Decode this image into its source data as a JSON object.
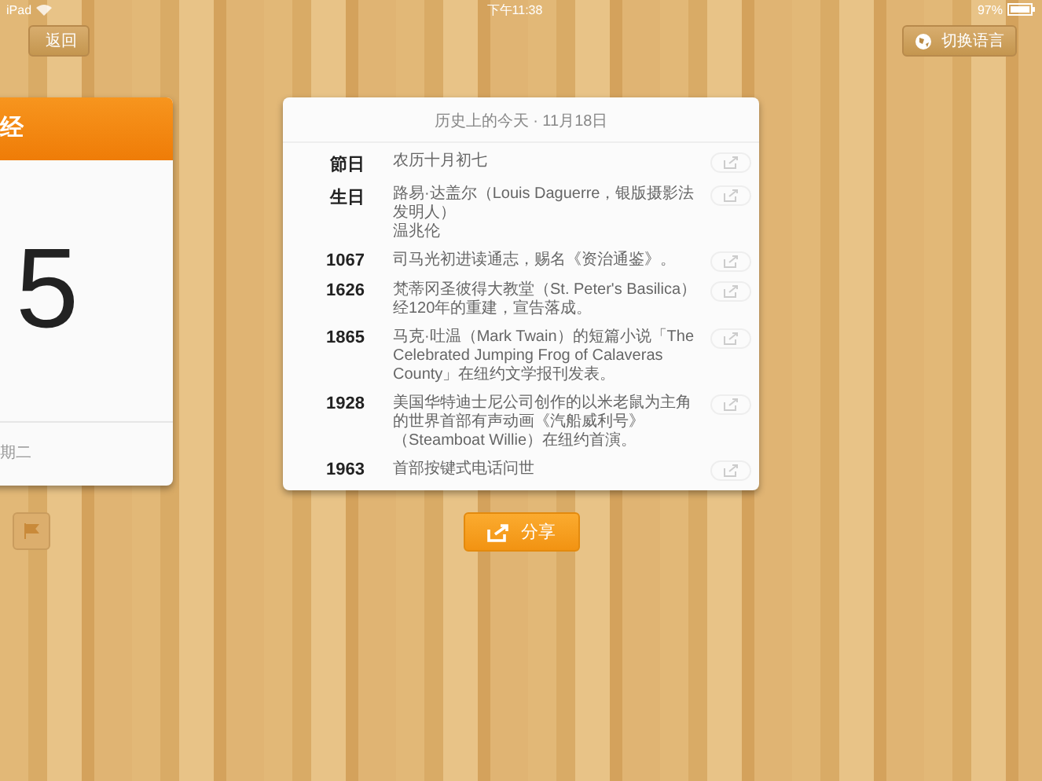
{
  "status_bar": {
    "device": "iPad",
    "time": "下午11:38",
    "battery": "97%"
  },
  "nav": {
    "back": "返回",
    "language": "切换语言"
  },
  "calendar_card": {
    "header": "经",
    "day": "5",
    "weekday": "期二"
  },
  "history_card": {
    "title": "历史上的今天 · 11月18日",
    "rows": [
      {
        "label": "節日",
        "lines": [
          "农历十月初七"
        ]
      },
      {
        "label": "生日",
        "lines": [
          "路易·达盖尔（Louis Daguerre，银版摄影法发明人）",
          "温兆伦"
        ]
      },
      {
        "label": "1067",
        "lines": [
          "司马光初进读通志，赐名《资治通鉴》。"
        ]
      },
      {
        "label": "1626",
        "lines": [
          "梵蒂冈圣彼得大教堂（St. Peter's Basilica）经120年的重建，宣告落成。"
        ]
      },
      {
        "label": "1865",
        "lines": [
          "马克·吐温（Mark Twain）的短篇小说「The Celebrated Jumping Frog of Calaveras County」在纽约文学报刊发表。"
        ]
      },
      {
        "label": "1928",
        "lines": [
          "美国华特迪士尼公司创作的以米老鼠为主角的世界首部有声动画《汽船威利号》（Steamboat Willie）在纽约首演。"
        ]
      },
      {
        "label": "1963",
        "lines": [
          "首部按键式电话问世"
        ]
      }
    ]
  },
  "share_button": "分享"
}
